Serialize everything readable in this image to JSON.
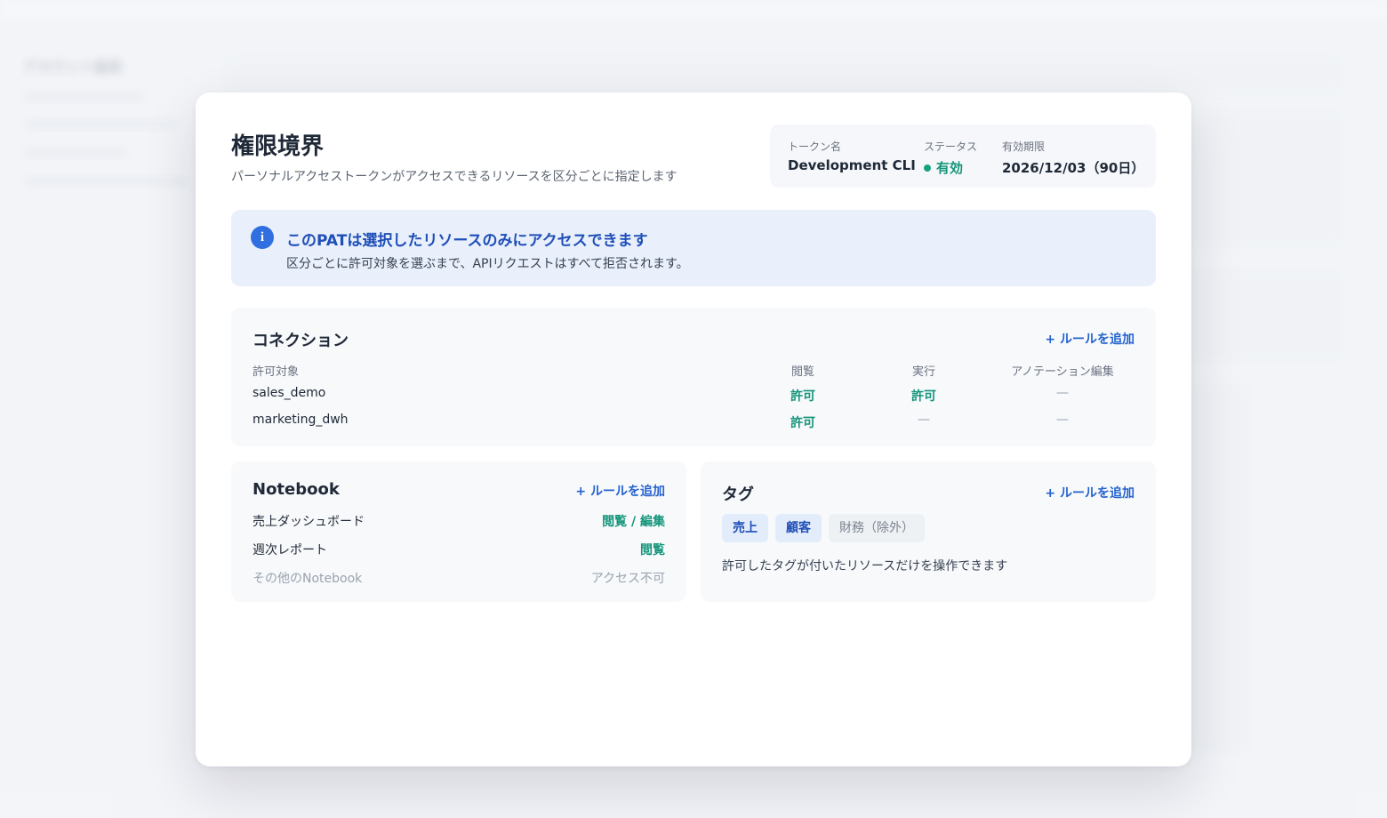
{
  "modal": {
    "title": "権限境界",
    "subtitle": "パーソナルアクセストークンがアクセスできるリソースを区分ごとに指定します"
  },
  "token": {
    "name_label": "トークン名",
    "name": "Development CLI",
    "status_label": "ステータス",
    "status": "有効",
    "expiry_label": "有効期限",
    "expiry": "2026/12/03（90日）"
  },
  "info": {
    "icon": "info-icon",
    "title": "このPATは選択したリソースのみにアクセスできます",
    "text": "区分ごとに許可対象を選ぶまで、APIリクエストはすべて拒否されます。"
  },
  "connections": {
    "title": "コネクション",
    "add_rule": "+ ルールを追加",
    "headers": [
      "許可対象",
      "閲覧",
      "実行",
      "アノテーション編集"
    ],
    "rows": [
      {
        "target": "sales_demo",
        "view": "許可",
        "run": "許可",
        "annotate": "—"
      },
      {
        "target": "marketing_dwh",
        "view": "許可",
        "run": "—",
        "annotate": "—"
      }
    ]
  },
  "notebook": {
    "title": "Notebook",
    "add_rule": "+ ルールを追加",
    "rows": [
      {
        "name": "売上ダッシュボード",
        "perm": "閲覧 / 編集"
      },
      {
        "name": "週次レポート",
        "perm": "閲覧"
      },
      {
        "name": "その他のNotebook",
        "perm": "アクセス不可"
      }
    ]
  },
  "tags": {
    "title": "タグ",
    "add_rule": "+ ルールを追加",
    "chips": [
      "売上",
      "顧客",
      "財務（除外）"
    ],
    "note": "許可したタグが付いたリソースだけを操作できます"
  },
  "background": {
    "title": "アカウント設定"
  },
  "colors": {
    "accent": "#2462cf",
    "allow": "#14957a",
    "info_bg": "#e9f0fc",
    "info_icon": "#2f6fe0"
  }
}
